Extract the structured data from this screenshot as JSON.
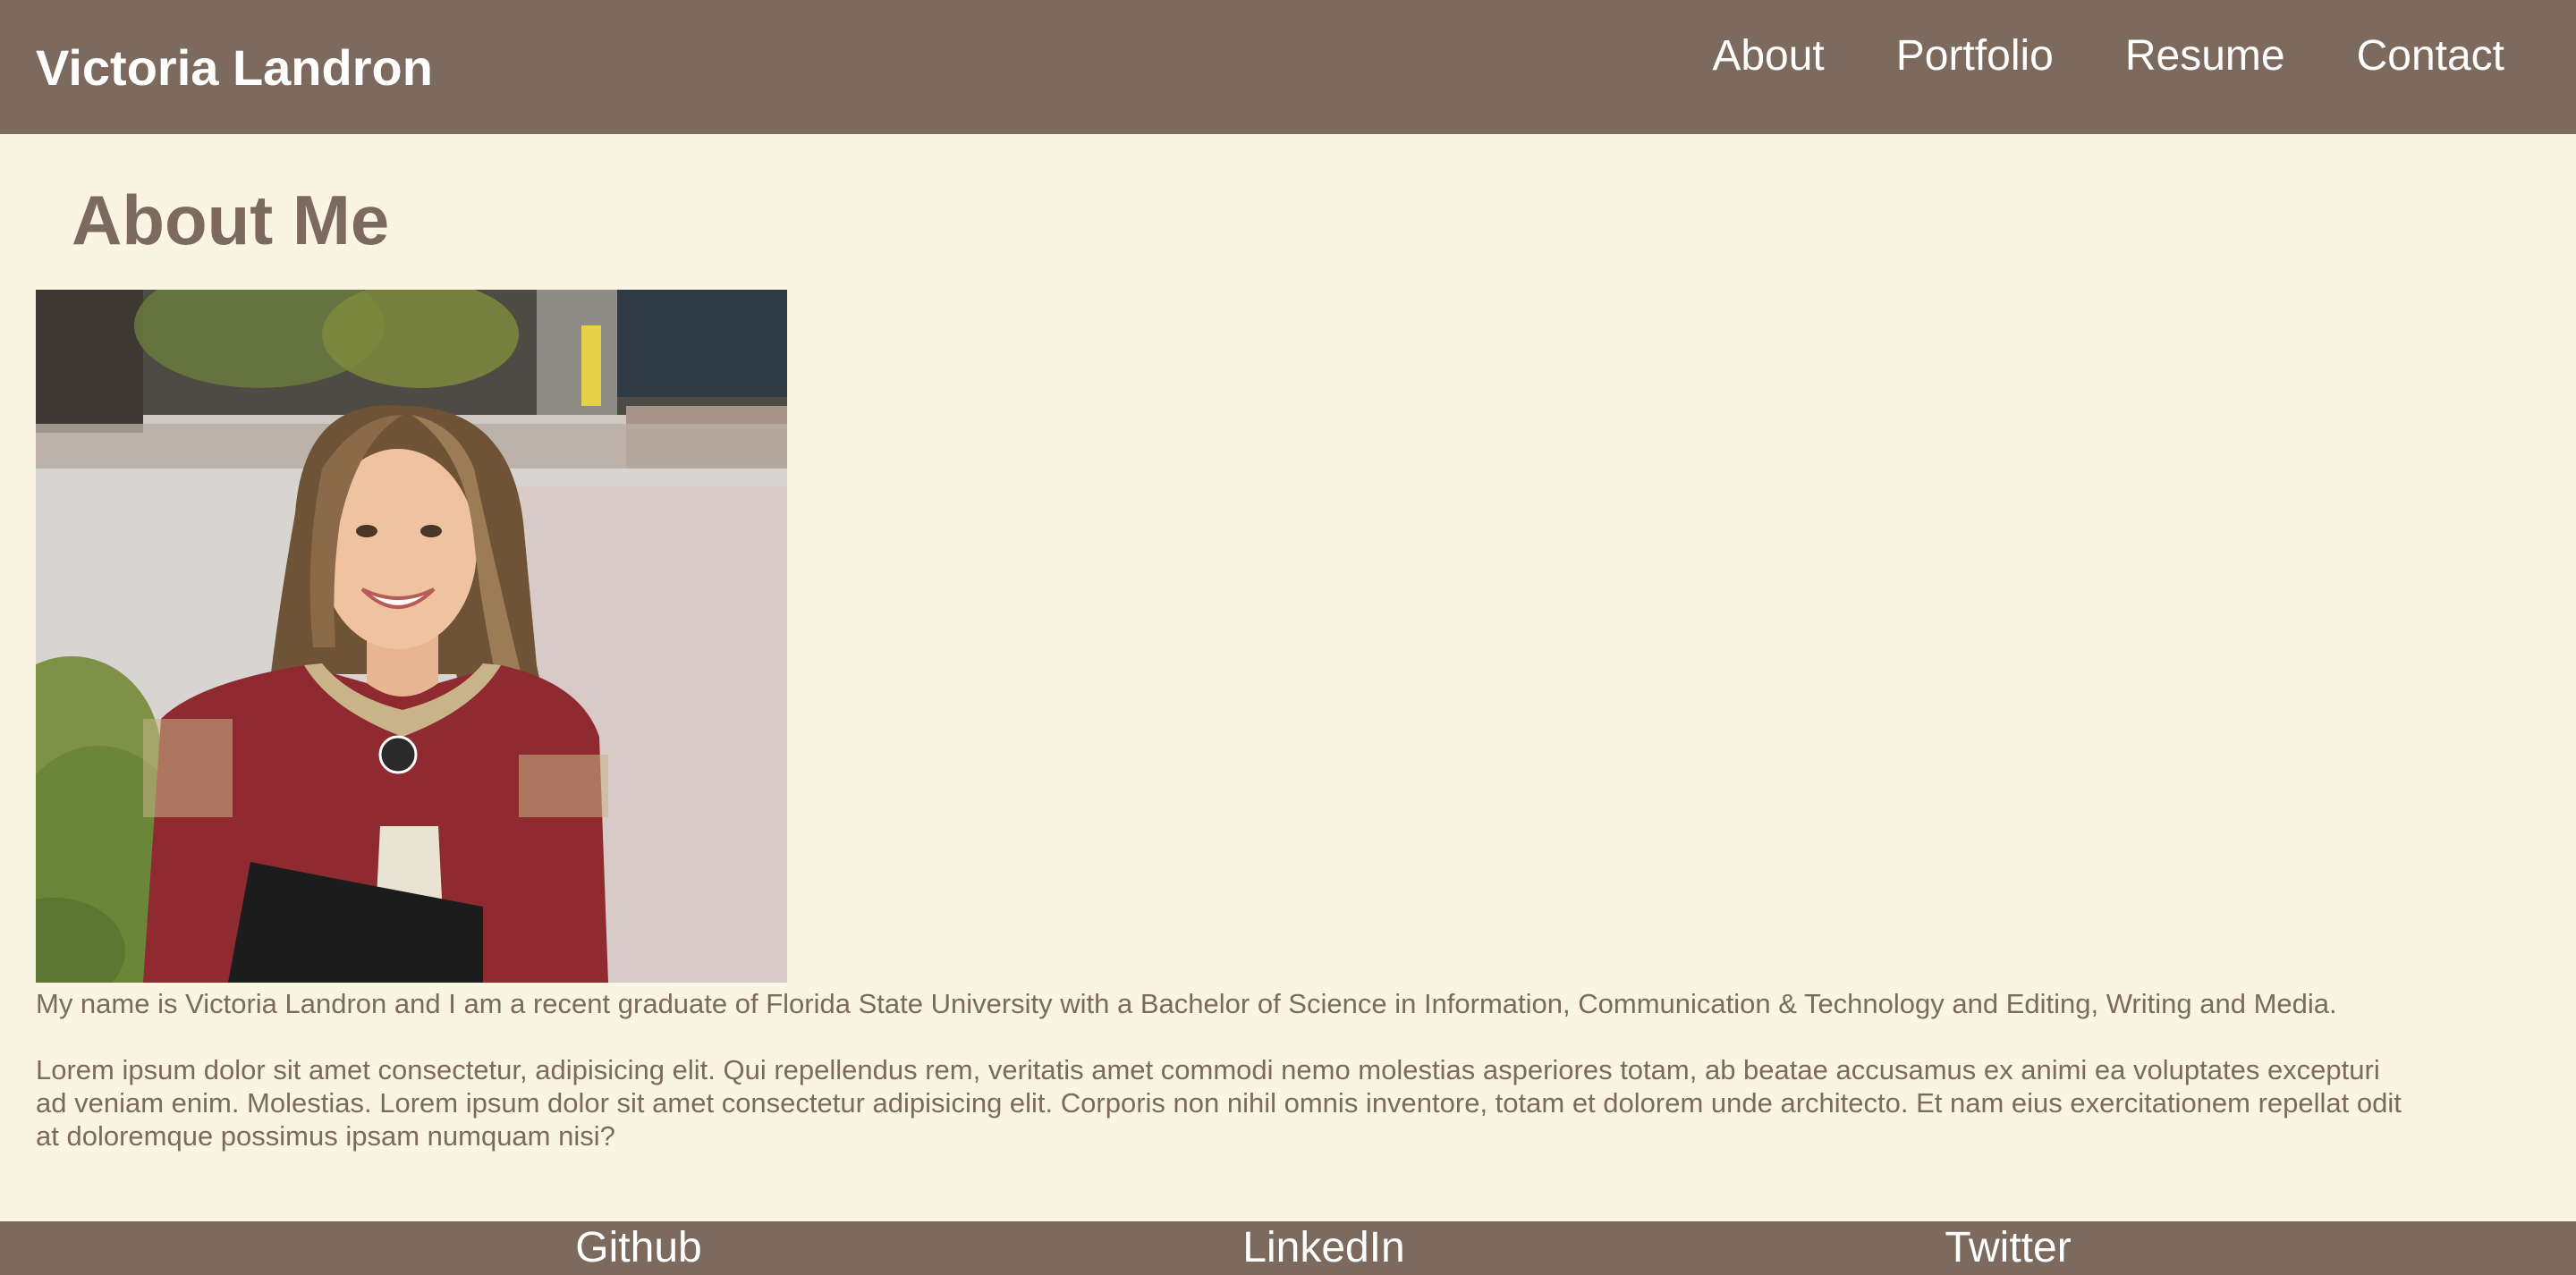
{
  "header": {
    "site_title": "Victoria Landron",
    "nav": [
      {
        "label": "About"
      },
      {
        "label": "Portfolio"
      },
      {
        "label": "Resume"
      },
      {
        "label": "Contact"
      }
    ]
  },
  "main": {
    "heading": "About Me",
    "photo_description": "profile-photo",
    "bio_paragraphs": [
      "My name is Victoria Landron and I am a recent graduate of Florida State University with a Bachelor of Science in Information, Communication & Technology and Editing, Writing and Media.",
      "Lorem ipsum dolor sit amet consectetur, adipisicing elit. Qui repellendus rem, veritatis amet commodi nemo molestias asperiores totam, ab beatae accusamus ex animi ea voluptates excepturi ad veniam enim. Molestias. Lorem ipsum dolor sit amet consectetur adipisicing elit. Corporis non nihil omnis inventore, totam et dolorem unde architecto. Et nam eius exercitationem repellat odit at doloremque possimus ipsam numquam nisi?"
    ]
  },
  "footer": {
    "links": [
      {
        "label": "Github"
      },
      {
        "label": "LinkedIn"
      },
      {
        "label": "Twitter"
      }
    ]
  },
  "colors": {
    "header_bg": "#7b6a5d",
    "page_bg": "#faf4e2",
    "text": "#7b6a5d",
    "nav_text": "#ffffff"
  }
}
